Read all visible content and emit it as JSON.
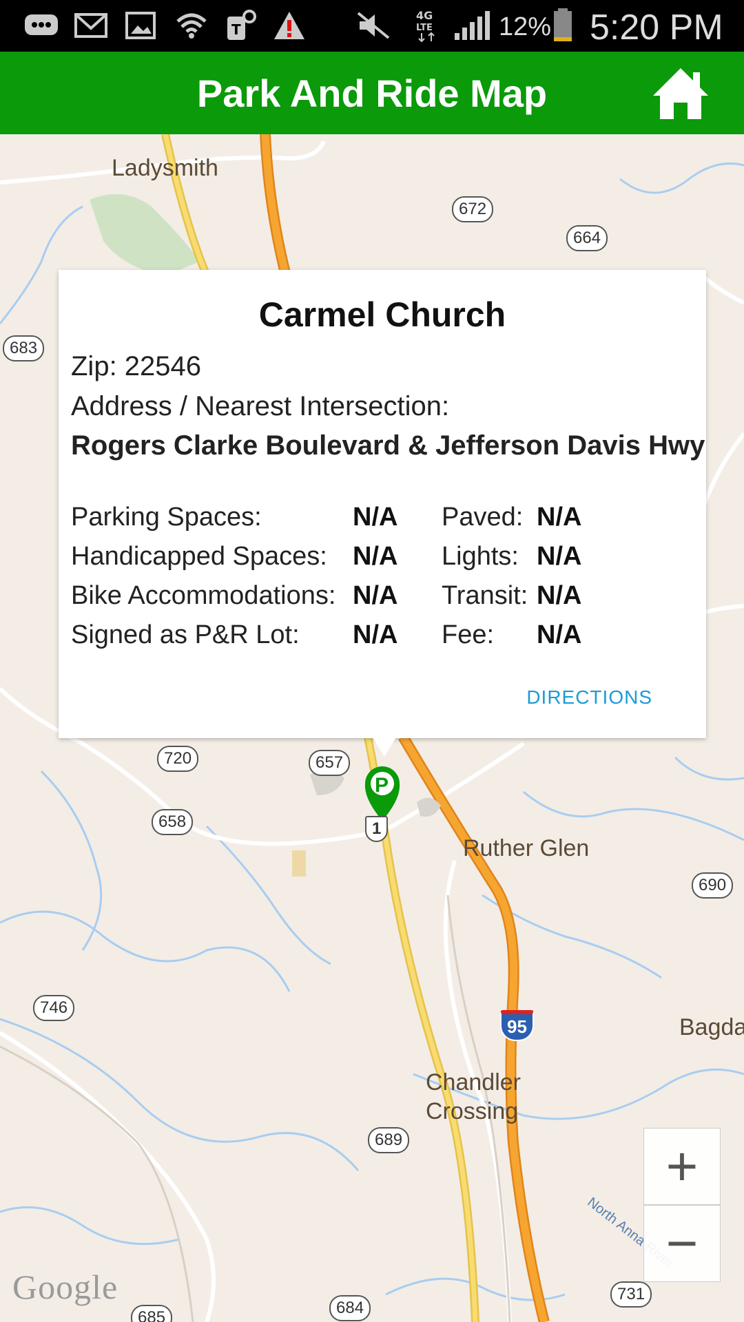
{
  "status_bar": {
    "battery_percent": "12%",
    "time": "5:20 PM",
    "network": "4G LTE",
    "icons": [
      "sms-icon",
      "gmail-icon",
      "gallery-icon",
      "wifi-icon",
      "tmobile-icon",
      "warning-icon",
      "mute-icon",
      "lte-icon",
      "signal-icon",
      "battery-icon"
    ]
  },
  "app_bar": {
    "title": "Park And Ride Map",
    "home_icon": "home-icon"
  },
  "popup": {
    "title": "Carmel Church",
    "zip": "Zip: 22546",
    "address_label": "Address / Nearest Intersection:",
    "address": "Rogers Clarke Boulevard & Jefferson Davis Hwy",
    "details_left": [
      {
        "label": "Parking Spaces:",
        "value": "N/A"
      },
      {
        "label": "Handicapped Spaces:",
        "value": "N/A"
      },
      {
        "label": "Bike Accommodations:",
        "value": "N/A"
      },
      {
        "label": "Signed as P&R Lot:",
        "value": "N/A"
      }
    ],
    "details_right": [
      {
        "label": "Paved:",
        "value": "N/A"
      },
      {
        "label": "Lights:",
        "value": "N/A"
      },
      {
        "label": "Transit:",
        "value": "N/A"
      },
      {
        "label": "Fee:",
        "value": "N/A"
      }
    ],
    "directions_label": "DIRECTIONS"
  },
  "map": {
    "places": [
      "Ladysmith",
      "Ruther Glen",
      "Chandler",
      "Crossing",
      "Bagda",
      "North Anna River"
    ],
    "route_shields": [
      "672",
      "664",
      "683",
      "720",
      "657",
      "658",
      "1",
      "690",
      "746",
      "95",
      "689",
      "684",
      "685",
      "731"
    ],
    "marker_letter": "P",
    "attribution": "Google",
    "zoom_in": "+",
    "zoom_out": "−"
  },
  "colors": {
    "app_bar": "#0a9a0a",
    "marker": "#0a9a0a",
    "link": "#1a9bd7",
    "interstate": "#f29a1d",
    "highway": "#f5d55a"
  }
}
